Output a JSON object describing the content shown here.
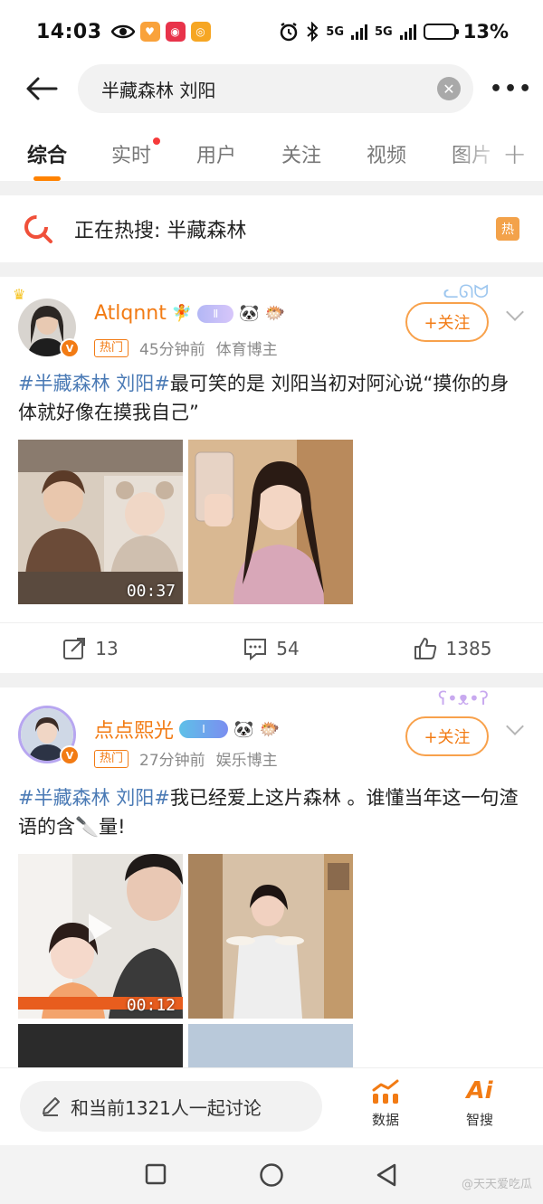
{
  "status_bar": {
    "time": "14:03",
    "network_1": "5G",
    "network_2": "5G",
    "battery_percent": "13%",
    "battery_level": 0.13,
    "app_badge_weibo_colors": [
      "#f9a23b",
      "#e8334a",
      "#f6a623"
    ]
  },
  "search": {
    "query": "半藏森林 刘阳",
    "clear_icon": "clear-circle-icon",
    "more_icon": "more-dots-icon"
  },
  "tabs": [
    {
      "label": "综合",
      "active": true
    },
    {
      "label": "实时",
      "has_dot": true
    },
    {
      "label": "用户"
    },
    {
      "label": "关注"
    },
    {
      "label": "视频"
    },
    {
      "label": "图片"
    }
  ],
  "tab_add": "+",
  "hot_search": {
    "text": "正在热搜: 半藏森林",
    "badge": "热"
  },
  "posts": [
    {
      "username": "Atlqnnt",
      "tag": "热门",
      "time": "45分钟前",
      "category": "体育博主",
      "follow_label": "+关注",
      "text_topic": "#半藏森林 刘阳#",
      "text_body": "最可笑的是 刘阳当初对阿沁说“摸你的身体就好像在摸我自己”",
      "video_duration": "00:37",
      "reposts": "13",
      "comments": "54",
      "likes": "1385"
    },
    {
      "username": "点点熙光",
      "tag": "热门",
      "time": "27分钟前",
      "category": "娱乐博主",
      "follow_label": "+关注",
      "text_topic": "#半藏森林 刘阳#",
      "text_body": "我已经爱上这片森林 。谁懂当年这一句渣语的含🔪量!",
      "video_duration": "00:12"
    }
  ],
  "bottom_bar": {
    "discuss_placeholder": "和当前1321人一起讨论",
    "data_label": "数据",
    "ai_label": "智搜",
    "ai_icon_text": "Ai"
  },
  "watermark": "@天天爱吃瓜",
  "accent": "#f27b14"
}
